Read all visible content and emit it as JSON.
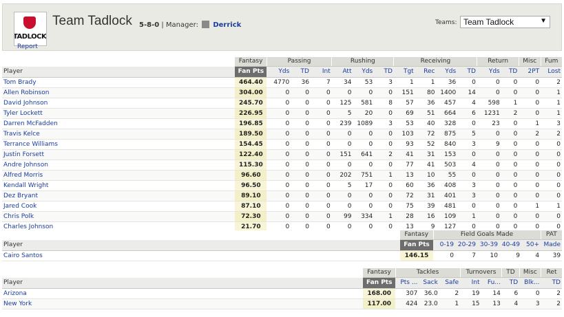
{
  "header": {
    "team_name": "Team Tadlock",
    "record": "5-8-0",
    "manager_label": "| Manager:",
    "manager_name": "Derrick",
    "logo_text": "TADLOCK",
    "report_link": "Report",
    "teams_label": "Teams:",
    "teams_selected": "Team Tadlock"
  },
  "offense": {
    "groups": [
      "Fantasy",
      "Passing",
      "Rushing",
      "Receiving",
      "Return",
      "Misc",
      "Fum"
    ],
    "columns": [
      "Player",
      "Fan Pts",
      "Yds",
      "TD",
      "Int",
      "Att",
      "Yds",
      "TD",
      "Tgt",
      "Rec",
      "Yds",
      "TD",
      "Yds",
      "TD",
      "2PT",
      "Lost"
    ],
    "rows": [
      [
        "Tom Brady",
        "464.40",
        "4770",
        "36",
        "7",
        "34",
        "53",
        "3",
        "1",
        "1",
        "36",
        "0",
        "0",
        "0",
        "0",
        "2"
      ],
      [
        "Allen Robinson",
        "304.00",
        "0",
        "0",
        "0",
        "0",
        "0",
        "0",
        "151",
        "80",
        "1400",
        "14",
        "0",
        "0",
        "0",
        "1"
      ],
      [
        "David Johnson",
        "245.70",
        "0",
        "0",
        "0",
        "125",
        "581",
        "8",
        "57",
        "36",
        "457",
        "4",
        "598",
        "1",
        "0",
        "1"
      ],
      [
        "Tyler Lockett",
        "226.95",
        "0",
        "0",
        "0",
        "5",
        "20",
        "0",
        "69",
        "51",
        "664",
        "6",
        "1231",
        "2",
        "0",
        "1"
      ],
      [
        "Darren McFadden",
        "196.85",
        "0",
        "0",
        "0",
        "239",
        "1089",
        "3",
        "53",
        "40",
        "328",
        "0",
        "23",
        "0",
        "1",
        "3"
      ],
      [
        "Travis Kelce",
        "189.50",
        "0",
        "0",
        "0",
        "0",
        "0",
        "0",
        "103",
        "72",
        "875",
        "5",
        "0",
        "0",
        "2",
        "2"
      ],
      [
        "Terrance Williams",
        "154.45",
        "0",
        "0",
        "0",
        "0",
        "0",
        "0",
        "93",
        "52",
        "840",
        "3",
        "9",
        "0",
        "0",
        "0"
      ],
      [
        "Justin Forsett",
        "122.40",
        "0",
        "0",
        "0",
        "151",
        "641",
        "2",
        "41",
        "31",
        "153",
        "0",
        "0",
        "0",
        "0",
        "0"
      ],
      [
        "Andre Johnson",
        "115.30",
        "0",
        "0",
        "0",
        "0",
        "0",
        "0",
        "77",
        "41",
        "503",
        "4",
        "0",
        "0",
        "0",
        "0"
      ],
      [
        "Alfred Morris",
        "96.60",
        "0",
        "0",
        "0",
        "202",
        "751",
        "1",
        "13",
        "10",
        "55",
        "0",
        "0",
        "0",
        "0",
        "0"
      ],
      [
        "Kendall Wright",
        "96.50",
        "0",
        "0",
        "0",
        "5",
        "17",
        "0",
        "60",
        "36",
        "408",
        "3",
        "0",
        "0",
        "0",
        "0"
      ],
      [
        "Dez Bryant",
        "89.10",
        "0",
        "0",
        "0",
        "0",
        "0",
        "0",
        "72",
        "31",
        "401",
        "3",
        "0",
        "0",
        "0",
        "0"
      ],
      [
        "Jared Cook",
        "87.10",
        "0",
        "0",
        "0",
        "0",
        "0",
        "0",
        "75",
        "39",
        "481",
        "0",
        "0",
        "0",
        "1",
        "1"
      ],
      [
        "Chris Polk",
        "72.30",
        "0",
        "0",
        "0",
        "99",
        "334",
        "1",
        "28",
        "16",
        "109",
        "1",
        "0",
        "0",
        "0",
        "0"
      ],
      [
        "Charles Johnson",
        "21.70",
        "0",
        "0",
        "0",
        "0",
        "0",
        "0",
        "13",
        "9",
        "127",
        "0",
        "0",
        "0",
        "0",
        "0"
      ]
    ]
  },
  "kicker": {
    "groups": [
      "Fantasy",
      "Field Goals Made",
      "PAT"
    ],
    "columns": [
      "Player",
      "Fan Pts",
      "0-19",
      "20-29",
      "30-39",
      "40-49",
      "50+",
      "Made"
    ],
    "rows": [
      [
        "Cairo Santos",
        "146.15",
        "0",
        "7",
        "10",
        "9",
        "4",
        "39"
      ]
    ]
  },
  "defense": {
    "groups": [
      "Fantasy",
      "Tackles",
      "Turnovers",
      "TD",
      "Misc",
      "Ret"
    ],
    "columns": [
      "Player",
      "Fan Pts",
      "Pts ...",
      "Sack",
      "Safe",
      "Int",
      "Fu...",
      "TD",
      "Blk...",
      "TD"
    ],
    "rows": [
      [
        "Arizona",
        "168.00",
        "307",
        "36.0",
        "2",
        "19",
        "14",
        "6",
        "0",
        "2"
      ],
      [
        "New York",
        "117.00",
        "424",
        "23.0",
        "1",
        "15",
        "13",
        "4",
        "3",
        "2"
      ]
    ]
  }
}
